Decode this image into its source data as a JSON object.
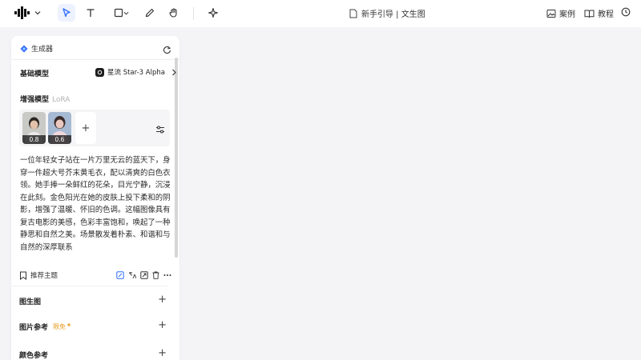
{
  "toolbar": {
    "tools": [
      "logo-menu",
      "select",
      "text",
      "shape",
      "pen",
      "hand",
      "ai-magic"
    ]
  },
  "header": {
    "doc_title": "新手引导 | 文生图",
    "cases_label": "案例",
    "tutorial_label": "教程"
  },
  "panel": {
    "title": "生成器",
    "base_model_label": "基础模型",
    "base_model_value": "星流 Star-3 Alpha",
    "lora_label": "增强模型",
    "lora_sub": "LoRA",
    "lora_items": [
      {
        "weight": "0.8"
      },
      {
        "weight": "0.6"
      }
    ],
    "add_symbol": "+",
    "prompt": "一位年轻女子站在一片万里无云的蓝天下，身穿一件超大号芥末黄毛衣，配以清爽的白色衣领。她手捧一朵鲜红的花朵，目光宁静，沉浸在此刻。金色阳光在她的皮肤上投下柔和的阴影，增强了温暖、怀旧的色调。这幅图像具有复古电影的美感，色彩丰富饱和，唤起了一种静思和自然之美。场景散发着朴素、和谐和与自然的深厚联系",
    "recommend_label": "推荐主题",
    "sections": [
      {
        "title": "图生图",
        "badge": ""
      },
      {
        "title": "图片参考",
        "badge": "限免"
      },
      {
        "title": "颜色参考",
        "badge": ""
      }
    ]
  },
  "colors": {
    "accent": "#2f6bff",
    "free_badge": "#e59a1c"
  }
}
